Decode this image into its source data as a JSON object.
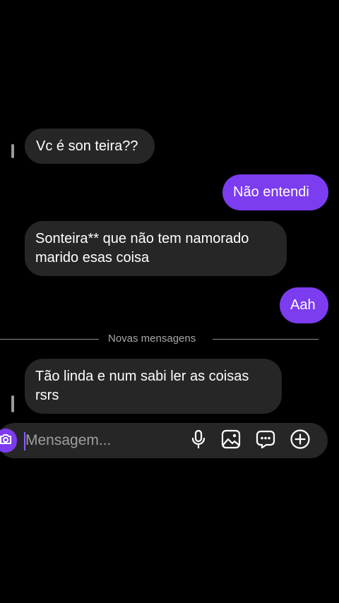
{
  "messages": [
    {
      "direction": "incoming",
      "text": "Vc é son teira??"
    },
    {
      "direction": "outgoing",
      "text": "Não entendi"
    },
    {
      "direction": "incoming",
      "lines": [
        "Sonteira** que não tem namorado",
        "marido esas coisa"
      ]
    },
    {
      "direction": "outgoing",
      "text": "Aah"
    },
    {
      "direction": "incoming",
      "lines": [
        "Tão linda e num sabi ler as coisas",
        "rsrs"
      ]
    }
  ],
  "divider": {
    "label": "Novas mensagens"
  },
  "composer": {
    "placeholder": "Mensagem...",
    "icons": [
      "camera-icon",
      "microphone-icon",
      "image-icon",
      "sticker-icon",
      "add-icon"
    ]
  },
  "colors": {
    "background": "#000000",
    "incoming_bubble": "#262626",
    "outgoing_bubble": "#7c3cf0",
    "divider_text": "#a8a8a8"
  }
}
